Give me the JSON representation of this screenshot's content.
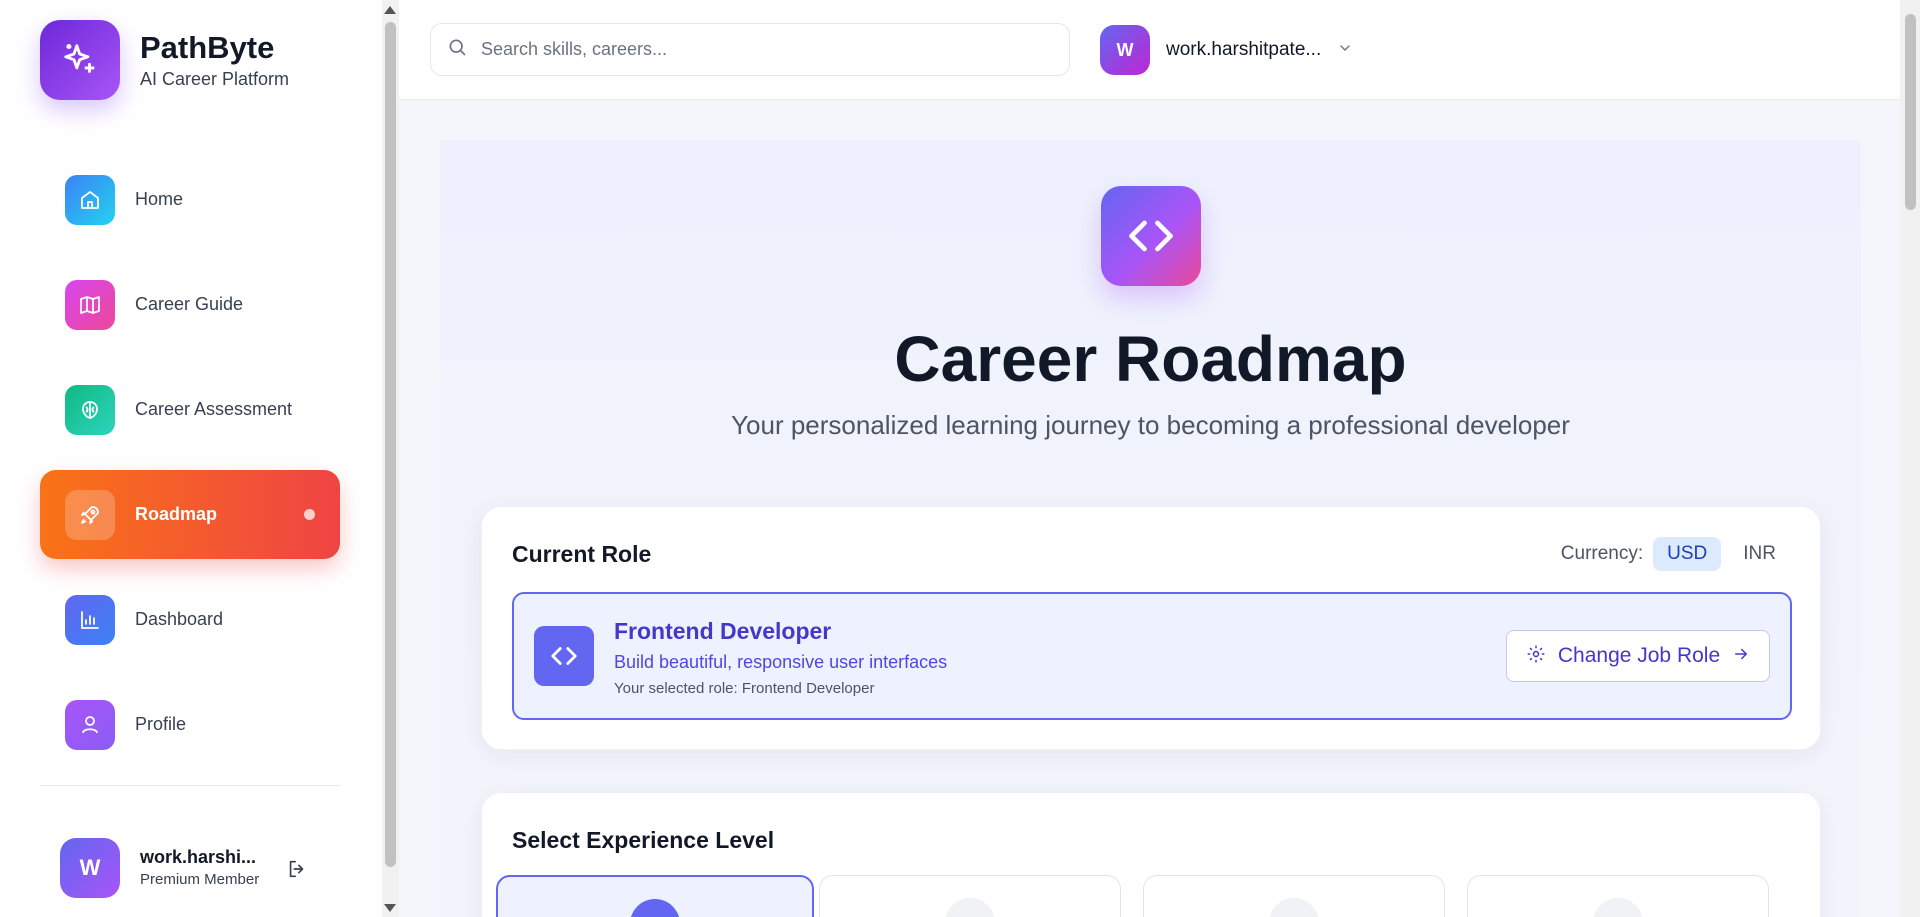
{
  "brand": {
    "name": "PathByte",
    "subtitle": "AI Career Platform",
    "logo_icon": "sparkles-icon"
  },
  "sidebar": {
    "items": [
      {
        "label": "Home",
        "icon": "home-icon",
        "color": "#3b82f6"
      },
      {
        "label": "Career Guide",
        "icon": "map-icon",
        "color": "#d946ef"
      },
      {
        "label": "Career Assessment",
        "icon": "brain-icon",
        "color": "#10b981"
      },
      {
        "label": "Roadmap",
        "icon": "rocket-icon",
        "active": true
      },
      {
        "label": "Dashboard",
        "icon": "bar-chart-icon",
        "color": "#6366f1"
      },
      {
        "label": "Profile",
        "icon": "user-icon",
        "color": "#a855f7"
      }
    ],
    "user": {
      "initial": "W",
      "name": "work.harshi...",
      "role": "Premium Member"
    }
  },
  "topbar": {
    "search_placeholder": "Search skills, careers...",
    "account": {
      "initial": "W",
      "name": "work.harshitpate..."
    }
  },
  "hero": {
    "title": "Career Roadmap",
    "subtitle": "Your personalized learning journey to becoming a professional developer"
  },
  "role_card": {
    "heading": "Current Role",
    "currency_label": "Currency:",
    "currencies": [
      "USD",
      "INR"
    ],
    "selected_currency": "USD",
    "role": {
      "title": "Frontend Developer",
      "description": "Build beautiful, responsive user interfaces",
      "note": "Your selected role: Frontend Developer"
    },
    "change_button": "Change Job Role"
  },
  "experience": {
    "heading": "Select Experience Level"
  },
  "colors": {
    "accent": "#6366f1",
    "active_nav_start": "#f97316",
    "active_nav_end": "#ef4444"
  }
}
